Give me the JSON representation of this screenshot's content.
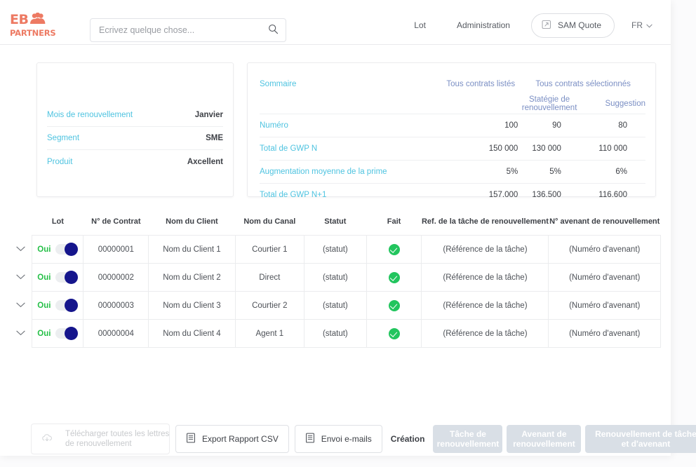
{
  "header": {
    "logo": {
      "mark": "EB",
      "word": "PARTNERS",
      "icon": "people-icon",
      "color": "#ed7a63"
    },
    "search": {
      "placeholder": "Ecrivez quelque chose...",
      "value": "",
      "icon": "search-icon"
    },
    "nav": [
      {
        "label": "Lot"
      },
      {
        "label": "Administration"
      }
    ],
    "sam_button": {
      "label": "SAM Quote",
      "icon": "external-window-icon"
    },
    "language": {
      "label": "FR",
      "icon": "chevron-down-icon"
    }
  },
  "info_card": {
    "rows": [
      {
        "key": "Mois de renouvellement",
        "value": "Janvier"
      },
      {
        "key": "Segment",
        "value": "SME"
      },
      {
        "key": "Produit",
        "value": "Axcellent"
      }
    ]
  },
  "summary_card": {
    "title": "Sommaire",
    "group_headers": {
      "listed": "Tous contrats listés",
      "selected": "Tous contrats sélectionnés"
    },
    "sub_headers": {
      "strategy": "Statégie de renouvellement",
      "suggestion": "Suggestion"
    },
    "rows": [
      {
        "label": "Numéro",
        "listed": "100",
        "strategy": "90",
        "suggestion": "80"
      },
      {
        "label": "Total de GWP N",
        "listed": "150 000",
        "strategy": "130 000",
        "suggestion": "110 000"
      },
      {
        "label": "Augmentation moyenne de la prime",
        "listed": "5%",
        "strategy": "5%",
        "suggestion": "6%"
      },
      {
        "label": "Total de GWP N+1",
        "listed": "157.000",
        "strategy": "136.500",
        "suggestion": "116.600"
      }
    ]
  },
  "table": {
    "columns": [
      "Lot",
      "N° de Contrat",
      "Nom du Client",
      "Nom du Canal",
      "Statut",
      "Fait",
      "Ref. de la tâche de renouvellement",
      "N° avenant de renouvellement"
    ],
    "rows": [
      {
        "lot_label": "Oui",
        "lot_on": true,
        "contract": "00000001",
        "client": "Nom du Client 1",
        "canal": "Courtier 1",
        "statut": "(statut)",
        "fait": true,
        "ref": "(Référence de la tâche)",
        "avenant": "(Numéro d'avenant)"
      },
      {
        "lot_label": "Oui",
        "lot_on": true,
        "contract": "00000002",
        "client": "Nom du Client 2",
        "canal": "Direct",
        "statut": "(statut)",
        "fait": true,
        "ref": "(Référence de la tâche)",
        "avenant": "(Numéro d'avenant)"
      },
      {
        "lot_label": "Oui",
        "lot_on": true,
        "contract": "00000003",
        "client": "Nom du Client 3",
        "canal": "Courtier 2",
        "statut": "(statut)",
        "fait": true,
        "ref": "(Référence de la tâche)",
        "avenant": "(Numéro d'avenant)"
      },
      {
        "lot_label": "Oui",
        "lot_on": true,
        "contract": "00000004",
        "client": "Nom du Client 4",
        "canal": "Agent 1",
        "statut": "(statut)",
        "fait": true,
        "ref": "(Référence de la tâche)",
        "avenant": "(Numéro d'avenant)"
      }
    ]
  },
  "footer": {
    "download_all": {
      "line1": "Télécharger toutes les lettres",
      "line2": "de renouvellement",
      "icon": "cloud-download-icon",
      "disabled": true
    },
    "export_csv": {
      "label": "Export Rapport CSV",
      "icon": "document-icon"
    },
    "send_emails": {
      "label": "Envoi e-mails",
      "icon": "document-icon"
    },
    "creation_label": "Création",
    "creation_buttons": [
      {
        "line1": "Tâche de",
        "line2": "renouvellement"
      },
      {
        "line1": "Avenant de",
        "line2": "renouvellement"
      },
      {
        "line1": "Renouvellement de tâche",
        "line2": "et d'avenant"
      }
    ]
  },
  "colors": {
    "brand": "#ed7a63",
    "accent_cyan": "#4ec3e0",
    "header_blue": "#7b8fc4",
    "toggle_knob": "#15158c",
    "success_green": "#22c55e",
    "muted_button": "#d9dfe6"
  }
}
